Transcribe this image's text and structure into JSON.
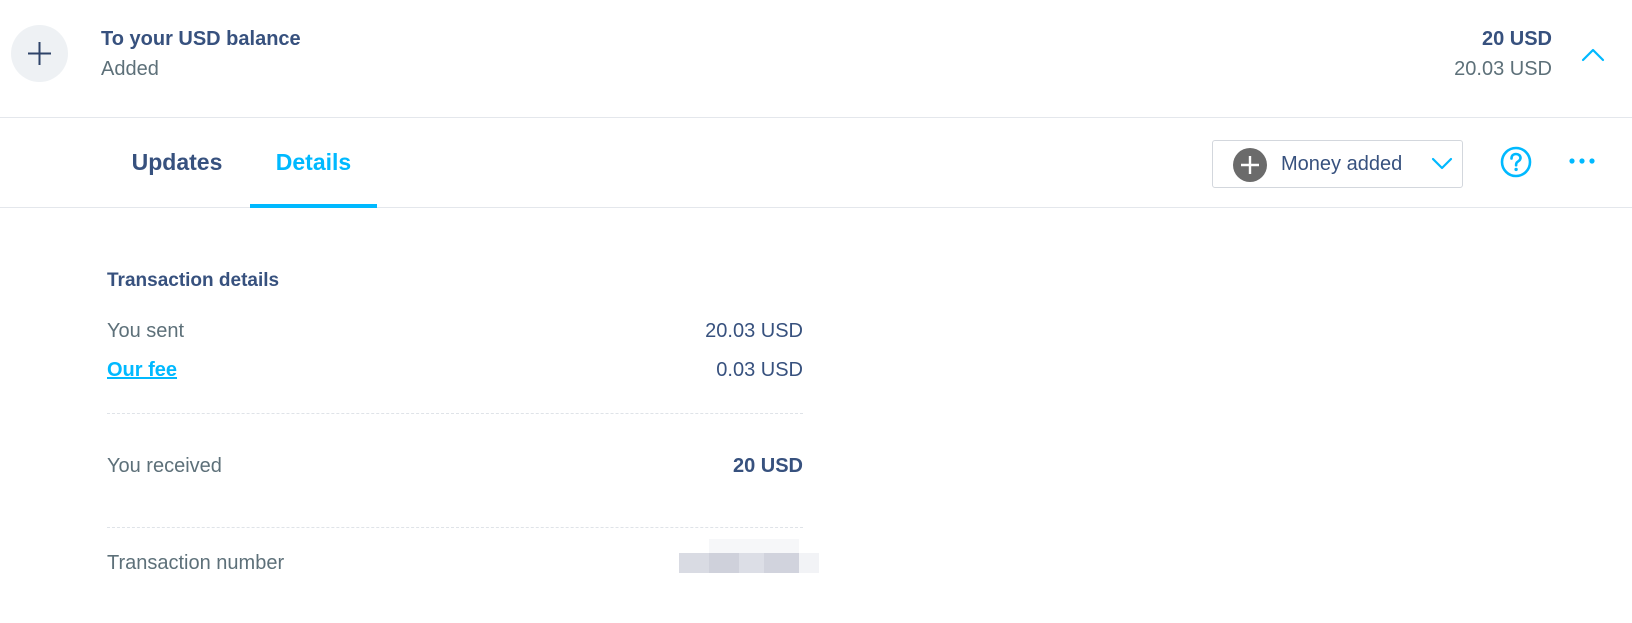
{
  "header": {
    "title": "To your USD balance",
    "subtitle": "Added",
    "amount_primary": "20 USD",
    "amount_secondary": "20.03 USD",
    "icons": {
      "add": "plus-icon",
      "collapse": "chevron-up-icon"
    }
  },
  "tabs": [
    {
      "label": "Updates",
      "active": false
    },
    {
      "label": "Details",
      "active": true
    }
  ],
  "toolbar": {
    "dropdown_label": "Money added",
    "dropdown_icon": "plus-circle-icon",
    "help_icon": "question-circle-icon",
    "more_icon": "more-dots-icon"
  },
  "details": {
    "title": "Transaction details",
    "rows": [
      {
        "label": "You sent",
        "value": "20.03 USD"
      },
      {
        "label": "Our fee",
        "value": "0.03 USD"
      },
      {
        "label": "You received",
        "value": "20 USD"
      },
      {
        "label": "Transaction number",
        "value": ""
      }
    ]
  },
  "colors": {
    "accent": "#00b9ff",
    "text_primary": "#37517e",
    "text_secondary": "#5d7079",
    "icon_bg": "#eef1f4",
    "dropdown_icon_bg": "#6b6b6b"
  }
}
